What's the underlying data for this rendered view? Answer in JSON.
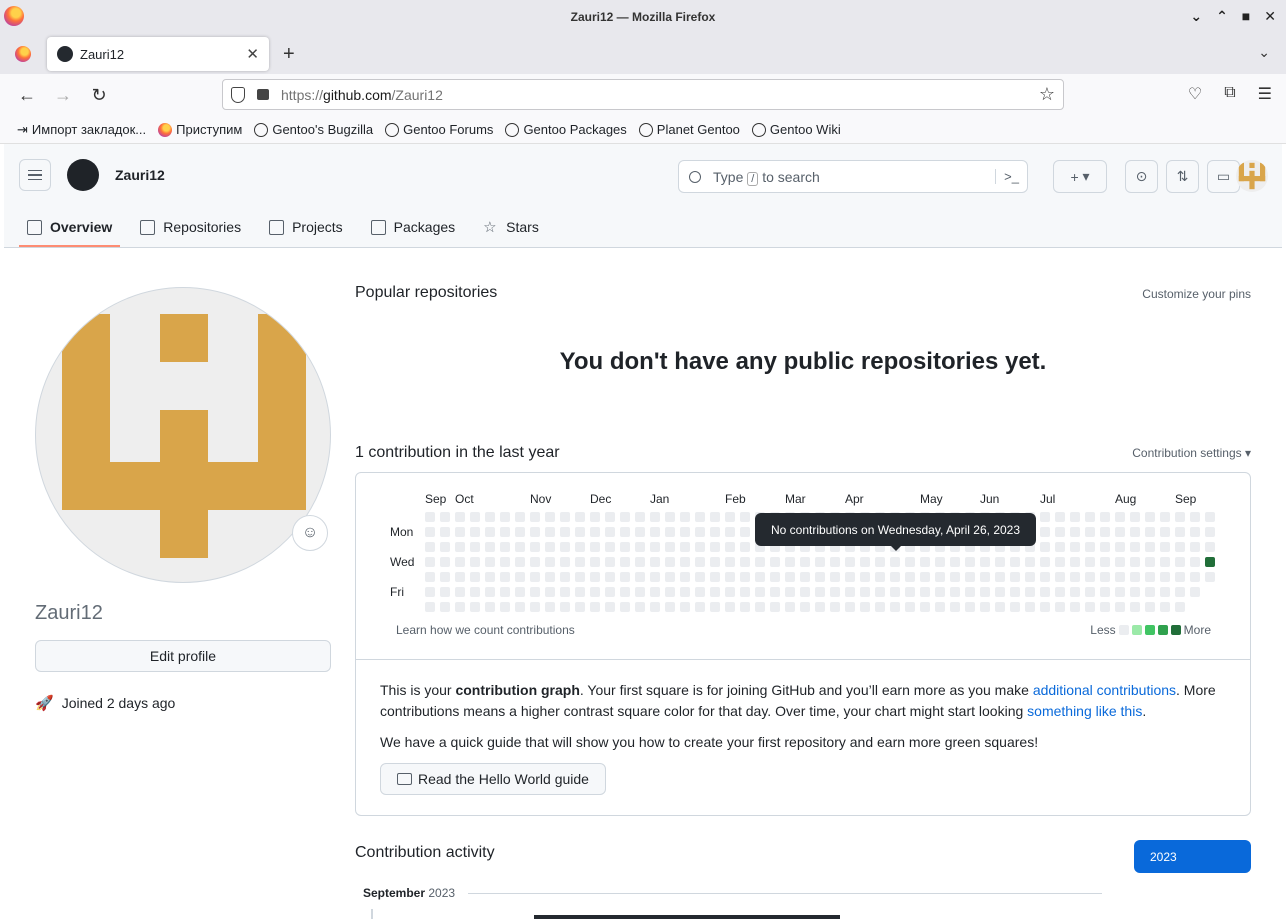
{
  "window": {
    "title": "Zauri12 — Mozilla Firefox"
  },
  "tab": {
    "title": "Zauri12",
    "close": "✕"
  },
  "urlbar": {
    "prefix": "https://",
    "domain": "github.com",
    "path": "/Zauri12"
  },
  "bookmarks": [
    {
      "label": "Импорт закладок...",
      "icon": "import-icon"
    },
    {
      "label": "Приступим",
      "icon": "firefox-icon"
    },
    {
      "label": "Gentoo's Bugzilla",
      "icon": "globe-icon"
    },
    {
      "label": "Gentoo Forums",
      "icon": "globe-icon"
    },
    {
      "label": "Gentoo Packages",
      "icon": "globe-icon"
    },
    {
      "label": "Planet Gentoo",
      "icon": "globe-icon"
    },
    {
      "label": "Gentoo Wiki",
      "icon": "globe-icon"
    }
  ],
  "header": {
    "username": "Zauri12",
    "search_before": "Type",
    "search_key": "/",
    "search_after": "to search",
    "plus": "+"
  },
  "nav": {
    "overview": "Overview",
    "repositories": "Repositories",
    "projects": "Projects",
    "packages": "Packages",
    "stars": "Stars"
  },
  "profile": {
    "name": "Zauri12",
    "edit": "Edit profile",
    "joined": "Joined 2 days ago"
  },
  "popular": {
    "title": "Popular repositories",
    "customize": "Customize your pins",
    "empty": "You don't have any public repositories yet."
  },
  "contrib": {
    "title": "1 contribution in the last year",
    "settings": "Contribution settings ▾",
    "months": [
      "Sep",
      "Oct",
      "Nov",
      "Dec",
      "Jan",
      "Feb",
      "Mar",
      "Apr",
      "May",
      "Jun",
      "Jul",
      "Aug",
      "Sep"
    ],
    "days": [
      "Mon",
      "Wed",
      "Fri"
    ],
    "tooltip": "No contributions on Wednesday, April 26, 2023",
    "learn": "Learn how we count contributions",
    "less": "Less",
    "more": "More",
    "legend_colors": [
      "#ebedf0",
      "#9be9a8",
      "#40c463",
      "#30a14e",
      "#216e39"
    ],
    "cells_per_week": 7,
    "weeks": 53,
    "active": {
      "week": 52,
      "day": 3,
      "level": 4
    }
  },
  "info": {
    "p1_a": "This is your ",
    "p1_b": "contribution graph",
    "p1_c": ". Your first square is for joining GitHub and you’ll earn more as you make ",
    "p1_link1": "additional contributions",
    "p1_d": ". More contributions means a higher contrast square color for that day. Over time, your chart might start looking ",
    "p1_link2": "something like this",
    "p1_e": ".",
    "p2": "We have a quick guide that will show you how to create your first repository and earn more green squares!",
    "guide_btn": "Read the Hello World guide"
  },
  "activity": {
    "title": "Contribution activity",
    "year": "2023",
    "month": "September",
    "month_year": "2023"
  }
}
